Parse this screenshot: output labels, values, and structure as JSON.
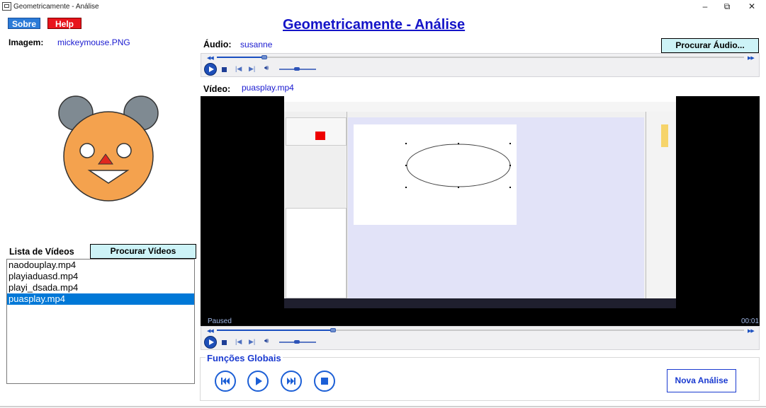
{
  "window": {
    "title": "Geometricamente - Análise",
    "minimize": "–",
    "maximize": "⧉",
    "close": "✕"
  },
  "buttons": {
    "sobre": "Sobre",
    "help": "Help",
    "procurar_audio": "Procurar Áudio...",
    "procurar_videos": "Procurar Vídeos",
    "nova_analise": "Nova Análise"
  },
  "header": {
    "title": "Geometricamente - Análise"
  },
  "imagem": {
    "label": "Imagem:",
    "value": "mickeymouse.PNG"
  },
  "audio": {
    "label": "Áudio:",
    "value": "susanne",
    "seek_progress": 0.09
  },
  "video": {
    "label": "Vídeo:",
    "value": "puasplay.mp4",
    "status": "Paused",
    "time": "00:01",
    "seek_progress": 0.22
  },
  "videos_list": {
    "label": "Lista de Vídeos",
    "items": [
      "naodouplay.mp4",
      "playiaduasd.mp4",
      "playi_dsada.mp4",
      "puasplay.mp4"
    ],
    "selected_index": 3
  },
  "globals": {
    "label": "Funções Globais"
  },
  "colors": {
    "title_blue": "#1414c8",
    "teal_button": "#cdf3f7",
    "help_red": "#e8141c",
    "sobre_blue": "#2b7bd8",
    "selection": "#0078d7",
    "accent": "#1c5fd6"
  },
  "icons": {
    "global_controls": [
      "skip-back-icon",
      "play-icon",
      "skip-forward-icon",
      "stop-icon"
    ]
  }
}
